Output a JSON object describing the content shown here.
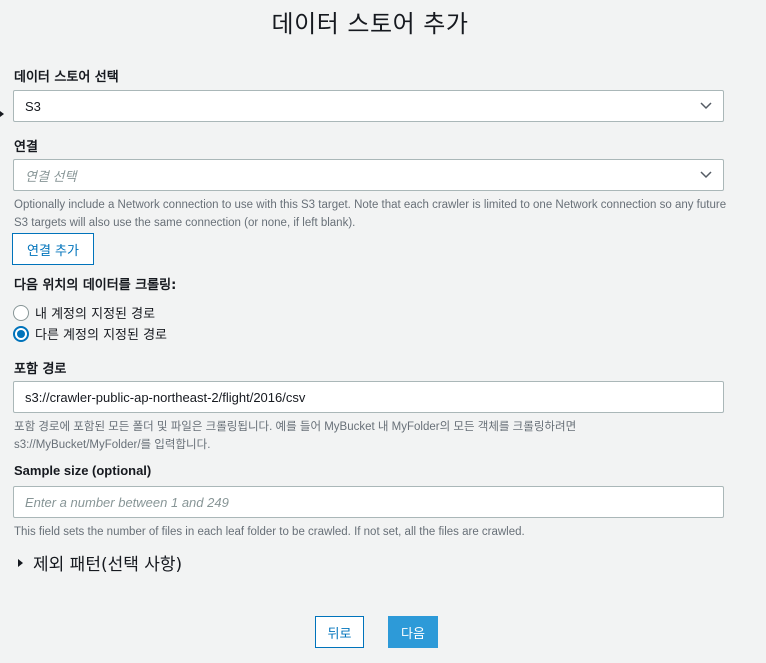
{
  "header": {
    "title": "데이터 스토어 추가"
  },
  "datastore": {
    "label": "데이터 스토어 선택",
    "selected": "S3"
  },
  "connection": {
    "label": "연결",
    "placeholder": "연결 선택",
    "hint": "Optionally include a Network connection to use with this S3 target. Note that each crawler is limited to one Network connection so any future S3 targets will also use the same connection (or none, if left blank).",
    "add_button": "연결 추가"
  },
  "crawl": {
    "label": "다음 위치의 데이터를 크롤링:",
    "options": [
      {
        "label": "내 계정의 지정된 경로",
        "checked": false
      },
      {
        "label": "다른 계정의 지정된 경로",
        "checked": true
      }
    ]
  },
  "include_path": {
    "label": "포함 경로",
    "value": "s3://crawler-public-ap-northeast-2/flight/2016/csv",
    "hint": "포함 경로에 포함된 모든 폴더 및 파일은 크롤링됩니다. 예를 들어 MyBucket 내 MyFolder의 모든 객체를 크롤링하려면 s3://MyBucket/MyFolder/를 입력합니다."
  },
  "sample_size": {
    "label": "Sample size (optional)",
    "placeholder": "Enter a number between 1 and 249",
    "hint": "This field sets the number of files in each leaf folder to be crawled. If not set, all the files are crawled."
  },
  "exclude": {
    "label": "제외 패턴(선택 사항)"
  },
  "footer": {
    "back": "뒤로",
    "next": "다음"
  },
  "icons": {
    "dropdown": "chevron-down-icon",
    "expand": "caret-right-icon"
  },
  "colors": {
    "accent": "#0073bb",
    "primary_button": "#2d9ad8",
    "background": "#f2f3f3"
  }
}
